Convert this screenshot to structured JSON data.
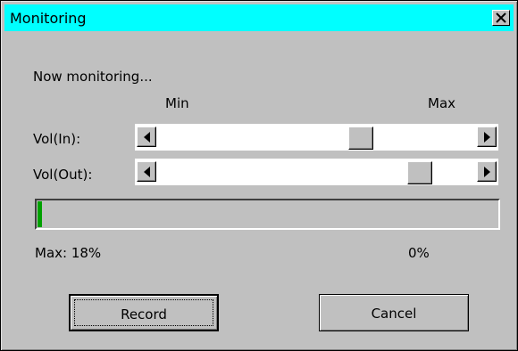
{
  "window": {
    "title": "Monitoring"
  },
  "status": {
    "text": "Now monitoring..."
  },
  "scale": {
    "min_label": "Min",
    "max_label": "Max"
  },
  "vol_in": {
    "label": "Vol(In):",
    "level_percent": 65
  },
  "vol_out": {
    "label": "Vol(Out):",
    "level_percent": 85
  },
  "meter": {
    "level_percent": 1,
    "max_text": "Max: 18%",
    "current_text": "0%",
    "color": "#00a000"
  },
  "buttons": {
    "record": "Record",
    "cancel": "Cancel"
  },
  "colors": {
    "titlebar": "#00ffff",
    "face": "#c0c0c0"
  },
  "icons": {
    "close": "close-icon",
    "left": "arrow-left-icon",
    "right": "arrow-right-icon"
  }
}
